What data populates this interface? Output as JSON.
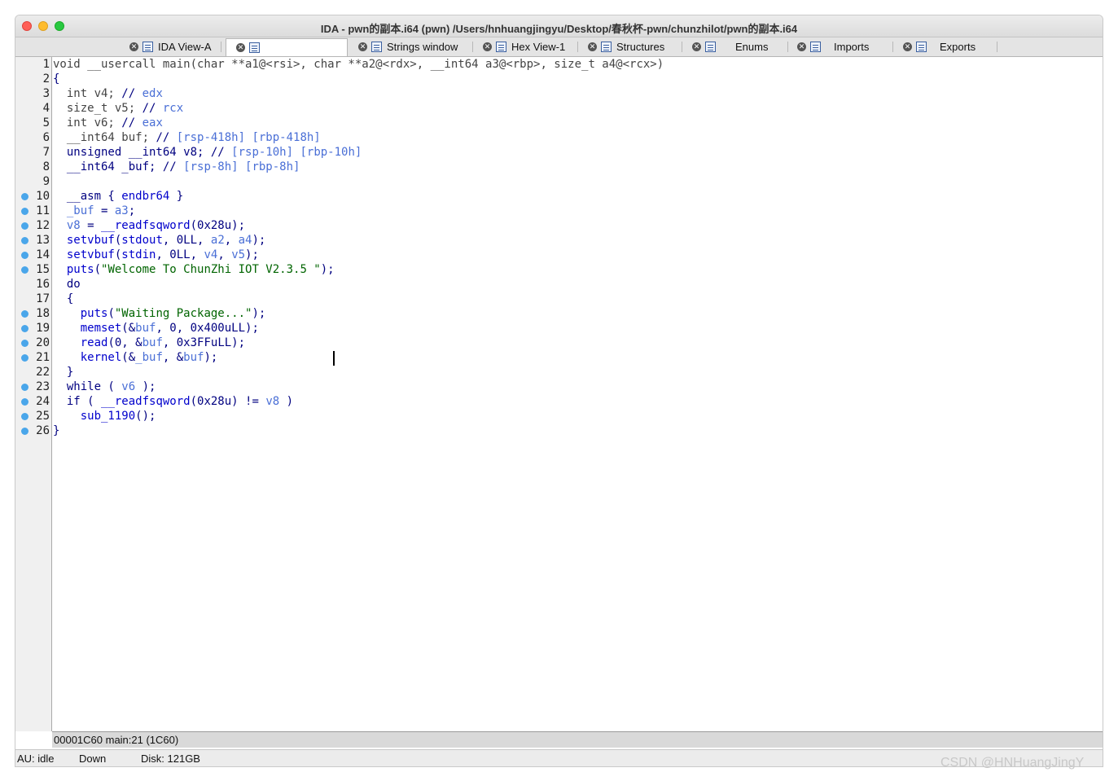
{
  "window": {
    "title": "IDA - pwn的副本.i64 (pwn) /Users/hnhuangjingyu/Desktop/春秋杯-pwn/chunzhilot/pwn的副本.i64"
  },
  "tabs": [
    {
      "label": "IDA View-A",
      "icon": "disassembly-icon",
      "active": false
    },
    {
      "label": "",
      "icon": "pseudocode-icon",
      "active": true
    },
    {
      "label": "Strings window",
      "icon": "strings-icon",
      "active": false
    },
    {
      "label": "Hex View-1",
      "icon": "hex-icon",
      "active": false
    },
    {
      "label": "Structures",
      "icon": "structures-icon",
      "active": false
    },
    {
      "label": "Enums",
      "icon": "enums-icon",
      "active": false
    },
    {
      "label": "Imports",
      "icon": "imports-icon",
      "active": false
    },
    {
      "label": "Exports",
      "icon": "exports-icon",
      "active": false
    }
  ],
  "code": [
    {
      "n": "1",
      "bp": false,
      "tokens": [
        [
          "decl",
          "void __usercall main(char **a1@<rsi>, char **a2@<rdx>, __int64 a3@<rbp>, size_t a4@<rcx>)"
        ]
      ]
    },
    {
      "n": "2",
      "bp": false,
      "tokens": [
        [
          "plain",
          "{"
        ]
      ]
    },
    {
      "n": "3",
      "bp": false,
      "tokens": [
        [
          "decl",
          "  int v4; "
        ],
        [
          "kw",
          "// "
        ],
        [
          "cmt",
          "edx"
        ]
      ]
    },
    {
      "n": "4",
      "bp": false,
      "tokens": [
        [
          "decl",
          "  size_t v5; "
        ],
        [
          "kw",
          "// "
        ],
        [
          "cmt",
          "rcx"
        ]
      ]
    },
    {
      "n": "5",
      "bp": false,
      "tokens": [
        [
          "decl",
          "  int v6; "
        ],
        [
          "kw",
          "// "
        ],
        [
          "cmt",
          "eax"
        ]
      ]
    },
    {
      "n": "6",
      "bp": false,
      "tokens": [
        [
          "decl",
          "  __int64 buf; "
        ],
        [
          "kw",
          "// "
        ],
        [
          "cmt",
          "[rsp-418h] [rbp-418h]"
        ]
      ]
    },
    {
      "n": "7",
      "bp": false,
      "tokens": [
        [
          "kw",
          "  unsigned __int64 v8; "
        ],
        [
          "kw",
          "// "
        ],
        [
          "cmt",
          "[rsp-10h] [rbp-10h]"
        ]
      ]
    },
    {
      "n": "8",
      "bp": false,
      "tokens": [
        [
          "kw",
          "  __int64 _buf; "
        ],
        [
          "kw",
          "// "
        ],
        [
          "cmt",
          "[rsp-8h] [rbp-8h]"
        ]
      ]
    },
    {
      "n": "9",
      "bp": false,
      "tokens": []
    },
    {
      "n": "10",
      "bp": true,
      "tokens": [
        [
          "kw",
          "  __asm { "
        ],
        [
          "fn",
          "endbr64"
        ],
        [
          "kw",
          " }"
        ]
      ]
    },
    {
      "n": "11",
      "bp": true,
      "tokens": [
        [
          "var",
          "  _buf"
        ],
        [
          "kw",
          " = "
        ],
        [
          "var",
          "a3"
        ],
        [
          "kw",
          ";"
        ]
      ]
    },
    {
      "n": "12",
      "bp": true,
      "tokens": [
        [
          "var",
          "  v8"
        ],
        [
          "kw",
          " = "
        ],
        [
          "fn",
          "__readfsqword"
        ],
        [
          "kw",
          "(0x28u);"
        ]
      ]
    },
    {
      "n": "13",
      "bp": true,
      "tokens": [
        [
          "fn",
          "  setvbuf"
        ],
        [
          "kw",
          "("
        ],
        [
          "fn",
          "stdout"
        ],
        [
          "kw",
          ", 0LL, "
        ],
        [
          "var",
          "a2"
        ],
        [
          "kw",
          ", "
        ],
        [
          "var",
          "a4"
        ],
        [
          "kw",
          ");"
        ]
      ]
    },
    {
      "n": "14",
      "bp": true,
      "tokens": [
        [
          "fn",
          "  setvbuf"
        ],
        [
          "kw",
          "("
        ],
        [
          "fn",
          "stdin"
        ],
        [
          "kw",
          ", 0LL, "
        ],
        [
          "var",
          "v4"
        ],
        [
          "kw",
          ", "
        ],
        [
          "var",
          "v5"
        ],
        [
          "kw",
          ");"
        ]
      ]
    },
    {
      "n": "15",
      "bp": true,
      "tokens": [
        [
          "fn",
          "  puts"
        ],
        [
          "kw",
          "("
        ],
        [
          "str",
          "\"Welcome To ChunZhi IOT V2.3.5 \""
        ],
        [
          "kw",
          ");"
        ]
      ]
    },
    {
      "n": "16",
      "bp": false,
      "tokens": [
        [
          "kw",
          "  do"
        ]
      ]
    },
    {
      "n": "17",
      "bp": false,
      "tokens": [
        [
          "kw",
          "  {"
        ]
      ]
    },
    {
      "n": "18",
      "bp": true,
      "tokens": [
        [
          "fn",
          "    puts"
        ],
        [
          "kw",
          "("
        ],
        [
          "str",
          "\"Waiting Package...\""
        ],
        [
          "kw",
          ");"
        ]
      ]
    },
    {
      "n": "19",
      "bp": true,
      "tokens": [
        [
          "fn",
          "    memset"
        ],
        [
          "kw",
          "(&"
        ],
        [
          "var",
          "buf"
        ],
        [
          "kw",
          ", 0, 0x400uLL);"
        ]
      ]
    },
    {
      "n": "20",
      "bp": true,
      "tokens": [
        [
          "fn",
          "    read"
        ],
        [
          "kw",
          "(0, &"
        ],
        [
          "var",
          "buf"
        ],
        [
          "kw",
          ", 0x3FFuLL);"
        ]
      ]
    },
    {
      "n": "21",
      "bp": true,
      "tokens": [
        [
          "fn",
          "    kernel"
        ],
        [
          "kw",
          "(&"
        ],
        [
          "var",
          "_buf"
        ],
        [
          "kw",
          ", &"
        ],
        [
          "var",
          "buf"
        ],
        [
          "kw",
          ");"
        ]
      ]
    },
    {
      "n": "22",
      "bp": false,
      "tokens": [
        [
          "kw",
          "  }"
        ]
      ]
    },
    {
      "n": "23",
      "bp": true,
      "tokens": [
        [
          "kw",
          "  while ( "
        ],
        [
          "var",
          "v6"
        ],
        [
          "kw",
          " );"
        ]
      ]
    },
    {
      "n": "24",
      "bp": true,
      "tokens": [
        [
          "kw",
          "  if ( "
        ],
        [
          "fn",
          "__readfsqword"
        ],
        [
          "kw",
          "(0x28u) != "
        ],
        [
          "var",
          "v8"
        ],
        [
          "kw",
          " )"
        ]
      ]
    },
    {
      "n": "25",
      "bp": true,
      "tokens": [
        [
          "fn",
          "    sub_1190"
        ],
        [
          "kw",
          "();"
        ]
      ]
    },
    {
      "n": "26",
      "bp": true,
      "tokens": [
        [
          "plain",
          "}"
        ]
      ]
    }
  ],
  "status": {
    "location": "00001C60  main:21 (1C60)"
  },
  "bottom": {
    "au": "AU:  idle",
    "direction": "Down",
    "disk": "Disk: 121GB"
  },
  "watermark": "CSDN @HNHuangJingY"
}
